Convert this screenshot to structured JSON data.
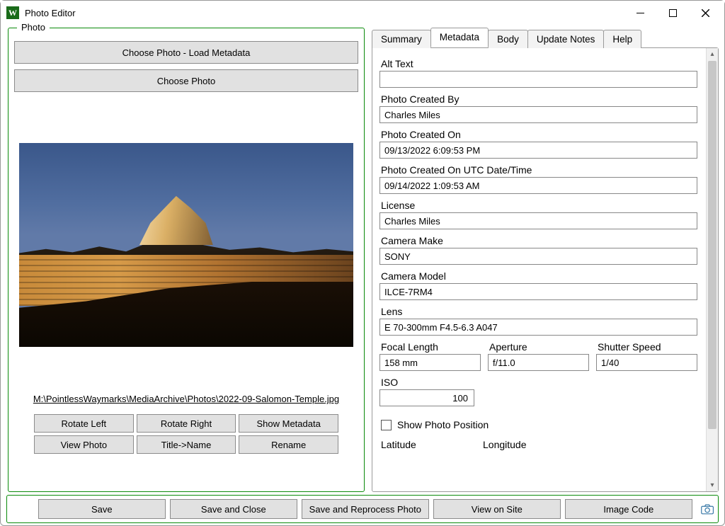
{
  "window": {
    "title": "Photo Editor",
    "icon_letter": "W"
  },
  "photo_group": {
    "legend": "Photo",
    "choose_load_label": "Choose Photo - Load Metadata",
    "choose_label": "Choose Photo",
    "file_path": "M:\\PointlessWaymarks\\MediaArchive\\Photos\\2022-09-Salomon-Temple.jpg",
    "buttons": {
      "rotate_left": "Rotate Left",
      "rotate_right": "Rotate Right",
      "show_metadata": "Show Metadata",
      "view_photo": "View Photo",
      "title_to_name": "Title->Name",
      "rename": "Rename"
    }
  },
  "tabs": {
    "summary": "Summary",
    "metadata": "Metadata",
    "body": "Body",
    "update_notes": "Update Notes",
    "help": "Help",
    "active": "metadata"
  },
  "metadata": {
    "alt_text": {
      "label": "Alt Text",
      "value": ""
    },
    "created_by": {
      "label": "Photo Created By",
      "value": "Charles Miles"
    },
    "created_on": {
      "label": "Photo Created On",
      "value": "09/13/2022 6:09:53 PM"
    },
    "created_on_utc": {
      "label": "Photo Created On UTC Date/Time",
      "value": "09/14/2022 1:09:53 AM"
    },
    "license": {
      "label": "License",
      "value": "Charles Miles"
    },
    "camera_make": {
      "label": "Camera Make",
      "value": "SONY"
    },
    "camera_model": {
      "label": "Camera Model",
      "value": "ILCE-7RM4"
    },
    "lens": {
      "label": "Lens",
      "value": "E 70-300mm F4.5-6.3 A047"
    },
    "focal_length": {
      "label": "Focal Length",
      "value": "158 mm"
    },
    "aperture": {
      "label": "Aperture",
      "value": "f/11.0"
    },
    "shutter_speed": {
      "label": "Shutter Speed",
      "value": "1/40"
    },
    "iso": {
      "label": "ISO",
      "value": "100"
    },
    "show_position": {
      "label": "Show Photo Position",
      "checked": false
    },
    "latitude_label": "Latitude",
    "longitude_label": "Longitude"
  },
  "footer": {
    "save": "Save",
    "save_close": "Save and Close",
    "save_reprocess": "Save and Reprocess Photo",
    "view_on_site": "View on Site",
    "image_code": "Image Code"
  }
}
